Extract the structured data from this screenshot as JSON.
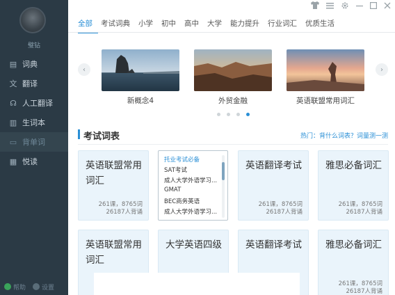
{
  "sidebar": {
    "username": "璧钻",
    "items": [
      {
        "label": "词典",
        "icon": "book-icon",
        "glyph": "▤"
      },
      {
        "label": "翻译",
        "icon": "translate-icon",
        "glyph": "文"
      },
      {
        "label": "人工翻译",
        "icon": "headset-icon",
        "glyph": "☊"
      },
      {
        "label": "生词本",
        "icon": "notebook-icon",
        "glyph": "▥"
      },
      {
        "label": "背单词",
        "icon": "flashcard-icon",
        "glyph": "▭"
      },
      {
        "label": "悦读",
        "icon": "reading-icon",
        "glyph": "▦"
      }
    ],
    "footer": [
      {
        "label": "帮助",
        "color": "#3aa35a"
      },
      {
        "label": "设置",
        "color": "#5a6d79"
      }
    ]
  },
  "tabs": [
    "全部",
    "考试词典",
    "小学",
    "初中",
    "高中",
    "大学",
    "能力提升",
    "行业词汇",
    "优质生活"
  ],
  "carousel": {
    "items": [
      {
        "caption": "新概念4"
      },
      {
        "caption": "外贸金融"
      },
      {
        "caption": "英语联盟常用词汇"
      }
    ]
  },
  "section": {
    "title": "考试词表",
    "hot_label": "热门",
    "hot_text": "：背什么词表？词量测一测"
  },
  "cards": [
    {
      "title": "英语联盟常用词汇",
      "lessons": "261课，8765词",
      "learners": "26187人背诵"
    },
    {
      "menu": [
        "托业考试必备",
        "SAT考试",
        "成人大学外语学习...",
        "GMAT",
        "BEC商务英语",
        "成人大学外语学习..."
      ]
    },
    {
      "title": "英语翻译考试",
      "lessons": "261课，8765词",
      "learners": "26187人背诵"
    },
    {
      "title": "雅思必备词汇",
      "lessons": "261课，8765词",
      "learners": "26187人背诵"
    },
    {
      "title": "英语联盟常用词汇",
      "lessons": "",
      "learners": ""
    },
    {
      "title": "大学英语四级",
      "lessons": "",
      "learners": ""
    },
    {
      "title": "英语翻译考试",
      "lessons": "",
      "learners": ""
    },
    {
      "title": "雅思必备词汇",
      "lessons": "261课，8765词",
      "learners": "26187人背诵"
    }
  ],
  "colors": {
    "accent": "#2a8fd6",
    "sidebar": "#2b3a45",
    "card": "#eaf4fb"
  }
}
